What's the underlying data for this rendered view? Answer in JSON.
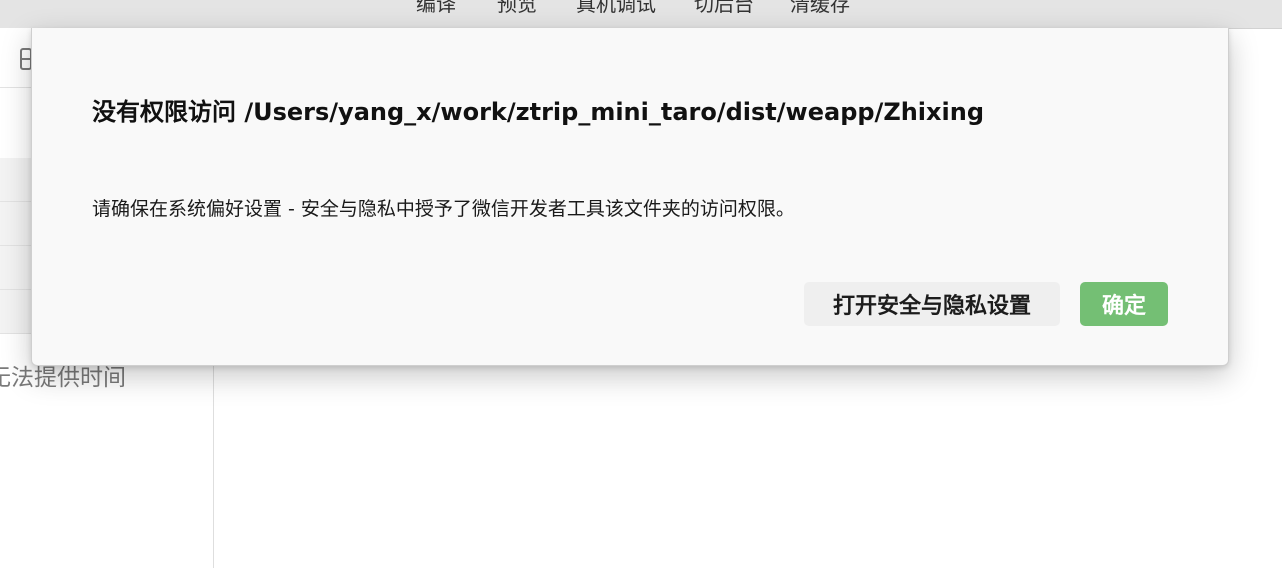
{
  "toolbar": {
    "items": [
      "编译",
      "预览",
      "真机调试",
      "切后台",
      "清缓存"
    ]
  },
  "sidebar": {
    "partial_text": "无法提供时间"
  },
  "dialog": {
    "title": "没有权限访问 /Users/yang_x/work/ztrip_mini_taro/dist/weapp/Zhixing",
    "message": "请确保在系统偏好设置 - 安全与隐私中授予了微信开发者工具该文件夹的访问权限。",
    "open_settings_label": "打开安全与隐私设置",
    "confirm_label": "确定"
  },
  "colors": {
    "confirm_button": "#74bf74",
    "secondary_button": "#efefef",
    "dialog_background": "#f9f9f9",
    "toolbar_background": "#e4e4e4"
  }
}
